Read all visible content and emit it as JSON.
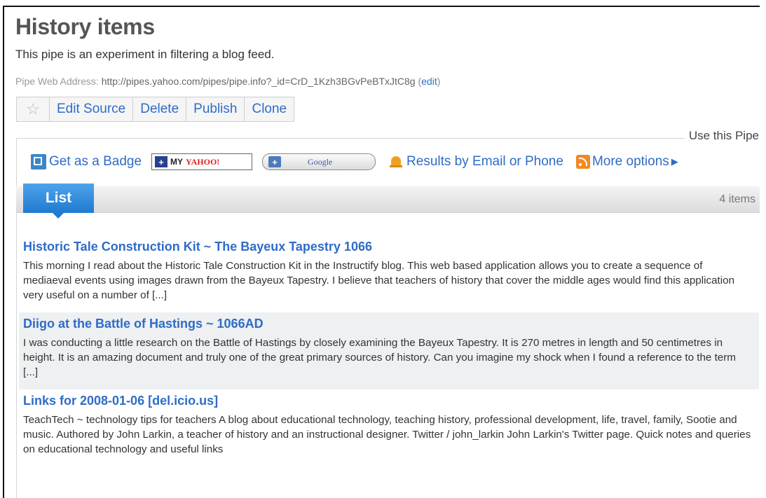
{
  "pipe": {
    "title": "History items",
    "description": "This pipe is an experiment in filtering a blog feed.",
    "address_label": "Pipe Web Address:",
    "address_url": "http://pipes.yahoo.com/pipes/pipe.info?_id=CrD_1Kzh3BGvPeBTxJtC8g",
    "address_open": "(",
    "edit_link": "edit",
    "address_close": ")"
  },
  "toolbar": {
    "star_icon": "star-icon",
    "edit_source": "Edit Source",
    "delete": "Delete",
    "publish": "Publish",
    "clone": "Clone"
  },
  "use_pipe": {
    "heading": "Use this Pipe",
    "badge": "Get as a Badge",
    "my_yahoo_plus": "+",
    "my_yahoo_my": "MY",
    "my_yahoo_brand": "YAHOO!",
    "google_plus": "+",
    "google_brand": "Google",
    "email_phone": "Results by Email or Phone",
    "more_options": "More options"
  },
  "list": {
    "tab_label": "List",
    "count": "4 items",
    "items": [
      {
        "title": "Historic Tale Construction Kit ~ The Bayeux Tapestry 1066",
        "summary": "This morning I read about the Historic Tale Construction Kit in the Instructify blog. This web based application allows you to create a sequence of mediaeval events using images drawn from the Bayeux Tapestry. I believe that teachers of history that cover the middle ages would find this application very useful on a number of [...]"
      },
      {
        "title": "Diigo at the Battle of Hastings ~ 1066AD",
        "summary": "I was conducting a little research on the Battle of Hastings by closely examining the Bayeux Tapestry. It is 270 metres in length and 50 centimetres in height. It is an amazing document and truly one of the great primary sources of history. Can you imagine my shock when I found a reference to the term [...]"
      },
      {
        "title": "Links for 2008-01-06 [del.icio.us]",
        "summary": "TeachTech ~ technology tips for teachers A blog about educational technology, teaching history, professional development, life, travel, family, Sootie and music. Authored by John Larkin, a teacher of history and an instructional designer. Twitter / john_larkin John Larkin's Twitter page. Quick notes and queries on educational technology and useful links"
      }
    ]
  },
  "colors": {
    "link": "#2f6cc7",
    "tab": "#2a8ae0"
  }
}
